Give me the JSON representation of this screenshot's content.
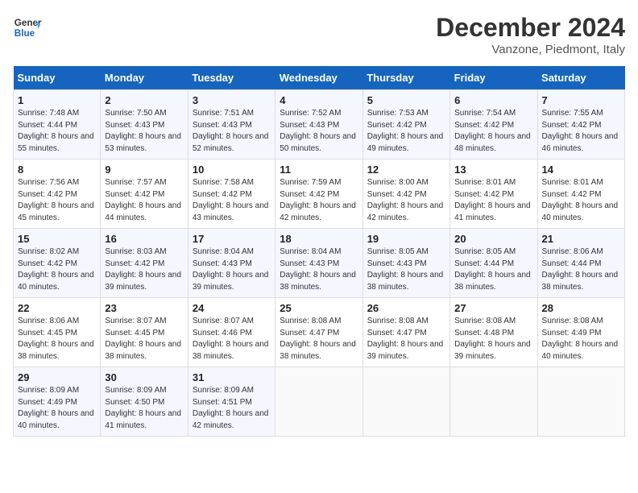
{
  "header": {
    "logo_line1": "General",
    "logo_line2": "Blue",
    "title": "December 2024",
    "subtitle": "Vanzone, Piedmont, Italy"
  },
  "columns": [
    "Sunday",
    "Monday",
    "Tuesday",
    "Wednesday",
    "Thursday",
    "Friday",
    "Saturday"
  ],
  "weeks": [
    [
      {
        "day": "1",
        "sunrise": "Sunrise: 7:48 AM",
        "sunset": "Sunset: 4:44 PM",
        "daylight": "Daylight: 8 hours and 55 minutes."
      },
      {
        "day": "2",
        "sunrise": "Sunrise: 7:50 AM",
        "sunset": "Sunset: 4:43 PM",
        "daylight": "Daylight: 8 hours and 53 minutes."
      },
      {
        "day": "3",
        "sunrise": "Sunrise: 7:51 AM",
        "sunset": "Sunset: 4:43 PM",
        "daylight": "Daylight: 8 hours and 52 minutes."
      },
      {
        "day": "4",
        "sunrise": "Sunrise: 7:52 AM",
        "sunset": "Sunset: 4:43 PM",
        "daylight": "Daylight: 8 hours and 50 minutes."
      },
      {
        "day": "5",
        "sunrise": "Sunrise: 7:53 AM",
        "sunset": "Sunset: 4:42 PM",
        "daylight": "Daylight: 8 hours and 49 minutes."
      },
      {
        "day": "6",
        "sunrise": "Sunrise: 7:54 AM",
        "sunset": "Sunset: 4:42 PM",
        "daylight": "Daylight: 8 hours and 48 minutes."
      },
      {
        "day": "7",
        "sunrise": "Sunrise: 7:55 AM",
        "sunset": "Sunset: 4:42 PM",
        "daylight": "Daylight: 8 hours and 46 minutes."
      }
    ],
    [
      {
        "day": "8",
        "sunrise": "Sunrise: 7:56 AM",
        "sunset": "Sunset: 4:42 PM",
        "daylight": "Daylight: 8 hours and 45 minutes."
      },
      {
        "day": "9",
        "sunrise": "Sunrise: 7:57 AM",
        "sunset": "Sunset: 4:42 PM",
        "daylight": "Daylight: 8 hours and 44 minutes."
      },
      {
        "day": "10",
        "sunrise": "Sunrise: 7:58 AM",
        "sunset": "Sunset: 4:42 PM",
        "daylight": "Daylight: 8 hours and 43 minutes."
      },
      {
        "day": "11",
        "sunrise": "Sunrise: 7:59 AM",
        "sunset": "Sunset: 4:42 PM",
        "daylight": "Daylight: 8 hours and 42 minutes."
      },
      {
        "day": "12",
        "sunrise": "Sunrise: 8:00 AM",
        "sunset": "Sunset: 4:42 PM",
        "daylight": "Daylight: 8 hours and 42 minutes."
      },
      {
        "day": "13",
        "sunrise": "Sunrise: 8:01 AM",
        "sunset": "Sunset: 4:42 PM",
        "daylight": "Daylight: 8 hours and 41 minutes."
      },
      {
        "day": "14",
        "sunrise": "Sunrise: 8:01 AM",
        "sunset": "Sunset: 4:42 PM",
        "daylight": "Daylight: 8 hours and 40 minutes."
      }
    ],
    [
      {
        "day": "15",
        "sunrise": "Sunrise: 8:02 AM",
        "sunset": "Sunset: 4:42 PM",
        "daylight": "Daylight: 8 hours and 40 minutes."
      },
      {
        "day": "16",
        "sunrise": "Sunrise: 8:03 AM",
        "sunset": "Sunset: 4:42 PM",
        "daylight": "Daylight: 8 hours and 39 minutes."
      },
      {
        "day": "17",
        "sunrise": "Sunrise: 8:04 AM",
        "sunset": "Sunset: 4:43 PM",
        "daylight": "Daylight: 8 hours and 39 minutes."
      },
      {
        "day": "18",
        "sunrise": "Sunrise: 8:04 AM",
        "sunset": "Sunset: 4:43 PM",
        "daylight": "Daylight: 8 hours and 38 minutes."
      },
      {
        "day": "19",
        "sunrise": "Sunrise: 8:05 AM",
        "sunset": "Sunset: 4:43 PM",
        "daylight": "Daylight: 8 hours and 38 minutes."
      },
      {
        "day": "20",
        "sunrise": "Sunrise: 8:05 AM",
        "sunset": "Sunset: 4:44 PM",
        "daylight": "Daylight: 8 hours and 38 minutes."
      },
      {
        "day": "21",
        "sunrise": "Sunrise: 8:06 AM",
        "sunset": "Sunset: 4:44 PM",
        "daylight": "Daylight: 8 hours and 38 minutes."
      }
    ],
    [
      {
        "day": "22",
        "sunrise": "Sunrise: 8:06 AM",
        "sunset": "Sunset: 4:45 PM",
        "daylight": "Daylight: 8 hours and 38 minutes."
      },
      {
        "day": "23",
        "sunrise": "Sunrise: 8:07 AM",
        "sunset": "Sunset: 4:45 PM",
        "daylight": "Daylight: 8 hours and 38 minutes."
      },
      {
        "day": "24",
        "sunrise": "Sunrise: 8:07 AM",
        "sunset": "Sunset: 4:46 PM",
        "daylight": "Daylight: 8 hours and 38 minutes."
      },
      {
        "day": "25",
        "sunrise": "Sunrise: 8:08 AM",
        "sunset": "Sunset: 4:47 PM",
        "daylight": "Daylight: 8 hours and 38 minutes."
      },
      {
        "day": "26",
        "sunrise": "Sunrise: 8:08 AM",
        "sunset": "Sunset: 4:47 PM",
        "daylight": "Daylight: 8 hours and 39 minutes."
      },
      {
        "day": "27",
        "sunrise": "Sunrise: 8:08 AM",
        "sunset": "Sunset: 4:48 PM",
        "daylight": "Daylight: 8 hours and 39 minutes."
      },
      {
        "day": "28",
        "sunrise": "Sunrise: 8:08 AM",
        "sunset": "Sunset: 4:49 PM",
        "daylight": "Daylight: 8 hours and 40 minutes."
      }
    ],
    [
      {
        "day": "29",
        "sunrise": "Sunrise: 8:09 AM",
        "sunset": "Sunset: 4:49 PM",
        "daylight": "Daylight: 8 hours and 40 minutes."
      },
      {
        "day": "30",
        "sunrise": "Sunrise: 8:09 AM",
        "sunset": "Sunset: 4:50 PM",
        "daylight": "Daylight: 8 hours and 41 minutes."
      },
      {
        "day": "31",
        "sunrise": "Sunrise: 8:09 AM",
        "sunset": "Sunset: 4:51 PM",
        "daylight": "Daylight: 8 hours and 42 minutes."
      },
      null,
      null,
      null,
      null
    ]
  ]
}
